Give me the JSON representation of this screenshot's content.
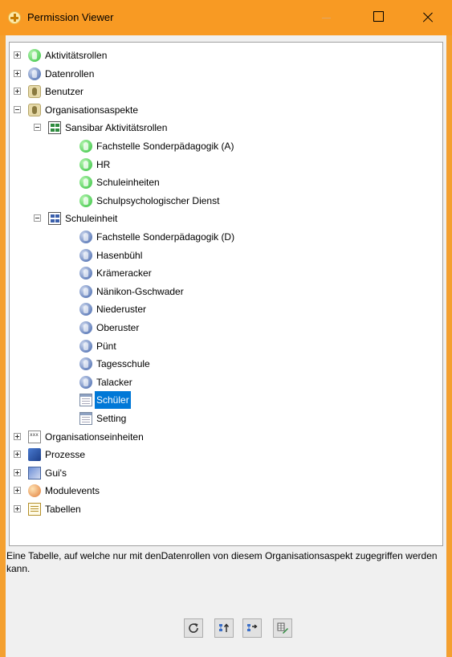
{
  "window": {
    "title": "Permission Viewer"
  },
  "tree": [
    {
      "label": "Aktivitätsrollen",
      "level": 0,
      "expander": "plus",
      "icon": "green-person-icon"
    },
    {
      "label": "Datenrollen",
      "level": 0,
      "expander": "plus",
      "icon": "blue-person-icon"
    },
    {
      "label": "Benutzer",
      "level": 0,
      "expander": "plus",
      "icon": "user-icon"
    },
    {
      "label": "Organisationsaspekte",
      "level": 0,
      "expander": "minus",
      "icon": "org-aspect-icon"
    },
    {
      "label": "Sansibar Aktivitätsrollen",
      "level": 1,
      "expander": "minus",
      "icon": "network-green-icon"
    },
    {
      "label": "Fachstelle Sonderpädagogik (A)",
      "level": 2,
      "icon": "green-person-icon"
    },
    {
      "label": "HR",
      "level": 2,
      "icon": "green-person-icon"
    },
    {
      "label": "Schuleinheiten",
      "level": 2,
      "icon": "green-person-icon"
    },
    {
      "label": "Schulpsychologischer Dienst",
      "level": 2,
      "icon": "green-person-icon"
    },
    {
      "label": "Schuleinheit",
      "level": 1,
      "expander": "minus",
      "icon": "network-blue-icon"
    },
    {
      "label": "Fachstelle Sonderpädagogik (D)",
      "level": 2,
      "icon": "blue-person-icon"
    },
    {
      "label": "Hasenbühl",
      "level": 2,
      "icon": "blue-person-icon"
    },
    {
      "label": "Krämeracker",
      "level": 2,
      "icon": "blue-person-icon"
    },
    {
      "label": "Nänikon-Gschwader",
      "level": 2,
      "icon": "blue-person-icon"
    },
    {
      "label": "Niederuster",
      "level": 2,
      "icon": "blue-person-icon"
    },
    {
      "label": "Oberuster",
      "level": 2,
      "icon": "blue-person-icon"
    },
    {
      "label": "Pünt",
      "level": 2,
      "icon": "blue-person-icon"
    },
    {
      "label": "Tagesschule",
      "level": 2,
      "icon": "blue-person-icon"
    },
    {
      "label": "Talacker",
      "level": 2,
      "icon": "blue-person-icon"
    },
    {
      "label": "Schüler",
      "level": 2,
      "icon": "table-icon",
      "selected": true
    },
    {
      "label": "Setting",
      "level": 2,
      "icon": "table-icon"
    },
    {
      "label": "Organisationseinheiten",
      "level": 0,
      "expander": "plus",
      "icon": "org-unit-icon"
    },
    {
      "label": "Prozesse",
      "level": 0,
      "expander": "plus",
      "icon": "process-icon"
    },
    {
      "label": "Gui's",
      "level": 0,
      "expander": "plus",
      "icon": "gui-icon"
    },
    {
      "label": "Modulevents",
      "level": 0,
      "expander": "plus",
      "icon": "module-events-icon"
    },
    {
      "label": "Tabellen",
      "level": 0,
      "expander": "plus",
      "icon": "tables-icon"
    }
  ],
  "description": "Eine Tabelle, auf welche nur mit denDatenrollen von diesem Organisationsaspekt zugegriffen werden kann.",
  "toolbar": [
    {
      "icon": "refresh-icon"
    },
    {
      "icon": "tree-up-icon"
    },
    {
      "icon": "tree-right-icon"
    },
    {
      "icon": "edit-table-icon"
    }
  ]
}
